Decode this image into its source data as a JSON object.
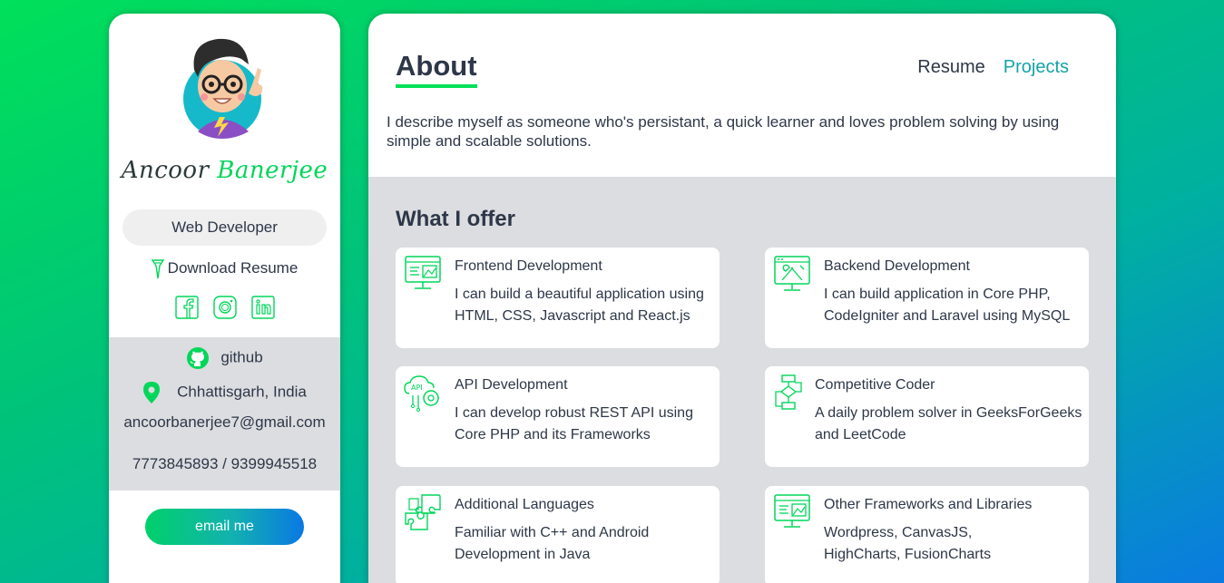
{
  "profile": {
    "first_name": "Ancoor",
    "last_name": "Banerjee",
    "role": "Web Developer",
    "download_label": "Download Resume",
    "socials": [
      "facebook-icon",
      "instagram-icon",
      "linkedin-icon"
    ],
    "github_label": "github",
    "location": "Chhattisgarh, India",
    "email": "ancoorbanerjee7@gmail.com",
    "phone": "7773845893 / 9399945518",
    "email_button": "email me"
  },
  "nav": {
    "title": "About",
    "resume": "Resume",
    "projects": "Projects"
  },
  "bio": "I describe myself as someone who's persistant, a quick learner and loves problem solving by using simple and scalable solutions.",
  "offer": {
    "title": "What I offer",
    "items": [
      {
        "icon": "monitor-code-icon",
        "title": "Frontend Development",
        "desc": "I can build a beautiful application using HTML, CSS, Javascript and React.js"
      },
      {
        "icon": "monitor-tools-icon",
        "title": "Backend Development",
        "desc": "I can build application in Core PHP, CodeIgniter and Laravel using MySQL"
      },
      {
        "icon": "api-gear-icon",
        "title": "API Development",
        "desc": "I can develop robust REST API using Core PHP and its Frameworks"
      },
      {
        "icon": "flowchart-icon",
        "title": "Competitive Coder",
        "desc": "A daily problem solver in GeeksForGeeks and LeetCode"
      },
      {
        "icon": "puzzle-icon",
        "title": "Additional Languages",
        "desc": "Familiar with C++ and Android Development in Java"
      },
      {
        "icon": "monitor-code-icon",
        "title": "Other Frameworks and Libraries",
        "desc": "Wordpress, CanvasJS, HighCharts, FusionCharts"
      }
    ]
  },
  "colors": {
    "accent_green": "#00e05a",
    "accent_teal": "#14a3a8",
    "text_dark": "#2d3748",
    "panel_gray": "#dcdde0"
  }
}
